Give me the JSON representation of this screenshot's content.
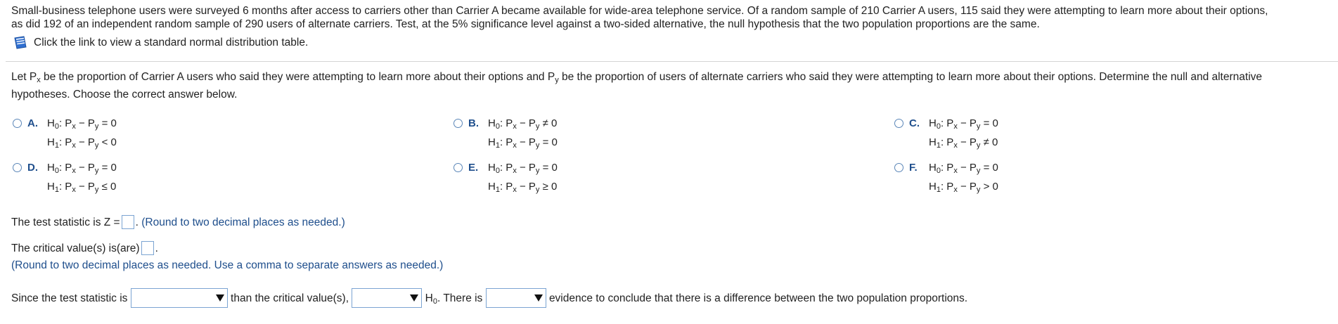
{
  "intro": {
    "line1": "Small-business telephone users were surveyed 6 months after access to carriers other than Carrier A became available for wide-area telephone service. Of a random sample of 210 Carrier A users, 115 said they were attempting to learn more about their options,",
    "line2": "as did 192 of an independent random sample of 290 users of alternate carriers. Test, at the 5% significance level against a two-sided alternative, the null hypothesis that the two population proportions are the same.",
    "link_text": "Click the link to view a standard normal distribution table."
  },
  "question": {
    "part1": "Let P",
    "sub_x": "x",
    "part2": " be the proportion of Carrier A users who said they were attempting to learn more about their options and P",
    "sub_y": "y",
    "part3": " be the proportion of users of alternate carriers who said they were attempting to learn more about their options. Determine the null and alternative",
    "line2": "hypotheses. Choose the correct answer below."
  },
  "symbols": {
    "H": "H",
    "sub0": "0",
    "sub1": "1",
    "colon_P": ": P",
    "x": "x",
    "minus_P": " − P",
    "y": "y"
  },
  "options": [
    {
      "letter": "A.",
      "h0_rel": " = 0",
      "h1_rel": " < 0"
    },
    {
      "letter": "B.",
      "h0_rel": " ≠ 0",
      "h1_rel": " = 0"
    },
    {
      "letter": "C.",
      "h0_rel": " = 0",
      "h1_rel": " ≠ 0"
    },
    {
      "letter": "D.",
      "h0_rel": " = 0",
      "h1_rel": " ≤ 0"
    },
    {
      "letter": "E.",
      "h0_rel": " = 0",
      "h1_rel": " ≥ 0"
    },
    {
      "letter": "F.",
      "h0_rel": " = 0",
      "h1_rel": " > 0"
    }
  ],
  "test_stat": {
    "prefix": "The test statistic is Z =",
    "suffix": ".",
    "hint": "(Round to two decimal places as needed.)"
  },
  "critical": {
    "prefix": "The critical value(s) is(are)",
    "suffix": ".",
    "hint": "(Round to two decimal places as needed. Use a comma to separate answers as needed.)"
  },
  "conclusion": {
    "part1": "Since the test statistic is",
    "part2": "than the critical value(s),",
    "H": "H",
    "sub0": "0",
    "part3": ". There is",
    "part4": "evidence to conclude that there is a difference between the two population proportions."
  }
}
